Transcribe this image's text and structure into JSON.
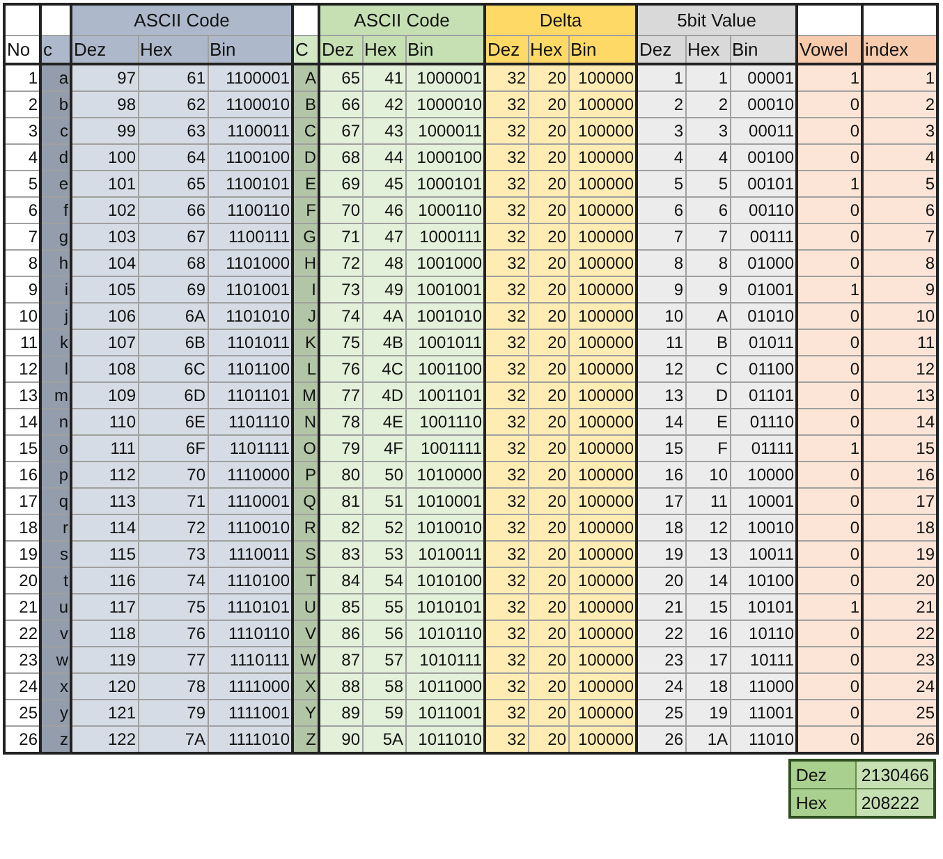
{
  "groups": [
    {
      "kind": "plain",
      "columns": [
        "No"
      ]
    },
    {
      "kind": "key",
      "color": "#adb9ca",
      "columns": [
        "c"
      ]
    },
    {
      "kind": "band",
      "label": "ASCII Code",
      "color": "#adb9ca",
      "columns": [
        "Dez",
        "Hex",
        "Bin"
      ]
    },
    {
      "kind": "key",
      "color": "#d3e8c5",
      "columns": [
        "C"
      ]
    },
    {
      "kind": "band",
      "label": "ASCII Code",
      "color": "#c6e0b4",
      "columns": [
        "Dez",
        "Hex",
        "Bin"
      ]
    },
    {
      "kind": "band",
      "label": "Delta",
      "color": "#ffd966",
      "columns": [
        "Dez",
        "Hex",
        "Bin"
      ]
    },
    {
      "kind": "band",
      "label": "5bit Value",
      "color": "#d9d9d9",
      "columns": [
        "Dez",
        "Hex",
        "Bin"
      ]
    },
    {
      "kind": "band",
      "color": "#f8cbad",
      "columns": [
        "Vowel"
      ]
    },
    {
      "kind": "band",
      "color": "#f8cbad",
      "columns": [
        "index"
      ]
    }
  ],
  "rows": [
    [
      "1",
      "a",
      "97",
      "61",
      "1100001",
      "A",
      "65",
      "41",
      "1000001",
      "32",
      "20",
      "100000",
      "1",
      "1",
      "00001",
      "1",
      "1"
    ],
    [
      "2",
      "b",
      "98",
      "62",
      "1100010",
      "B",
      "66",
      "42",
      "1000010",
      "32",
      "20",
      "100000",
      "2",
      "2",
      "00010",
      "0",
      "2"
    ],
    [
      "3",
      "c",
      "99",
      "63",
      "1100011",
      "C",
      "67",
      "43",
      "1000011",
      "32",
      "20",
      "100000",
      "3",
      "3",
      "00011",
      "0",
      "3"
    ],
    [
      "4",
      "d",
      "100",
      "64",
      "1100100",
      "D",
      "68",
      "44",
      "1000100",
      "32",
      "20",
      "100000",
      "4",
      "4",
      "00100",
      "0",
      "4"
    ],
    [
      "5",
      "e",
      "101",
      "65",
      "1100101",
      "E",
      "69",
      "45",
      "1000101",
      "32",
      "20",
      "100000",
      "5",
      "5",
      "00101",
      "1",
      "5"
    ],
    [
      "6",
      "f",
      "102",
      "66",
      "1100110",
      "F",
      "70",
      "46",
      "1000110",
      "32",
      "20",
      "100000",
      "6",
      "6",
      "00110",
      "0",
      "6"
    ],
    [
      "7",
      "g",
      "103",
      "67",
      "1100111",
      "G",
      "71",
      "47",
      "1000111",
      "32",
      "20",
      "100000",
      "7",
      "7",
      "00111",
      "0",
      "7"
    ],
    [
      "8",
      "h",
      "104",
      "68",
      "1101000",
      "H",
      "72",
      "48",
      "1001000",
      "32",
      "20",
      "100000",
      "8",
      "8",
      "01000",
      "0",
      "8"
    ],
    [
      "9",
      "i",
      "105",
      "69",
      "1101001",
      "I",
      "73",
      "49",
      "1001001",
      "32",
      "20",
      "100000",
      "9",
      "9",
      "01001",
      "1",
      "9"
    ],
    [
      "10",
      "j",
      "106",
      "6A",
      "1101010",
      "J",
      "74",
      "4A",
      "1001010",
      "32",
      "20",
      "100000",
      "10",
      "A",
      "01010",
      "0",
      "10"
    ],
    [
      "11",
      "k",
      "107",
      "6B",
      "1101011",
      "K",
      "75",
      "4B",
      "1001011",
      "32",
      "20",
      "100000",
      "11",
      "B",
      "01011",
      "0",
      "11"
    ],
    [
      "12",
      "l",
      "108",
      "6C",
      "1101100",
      "L",
      "76",
      "4C",
      "1001100",
      "32",
      "20",
      "100000",
      "12",
      "C",
      "01100",
      "0",
      "12"
    ],
    [
      "13",
      "m",
      "109",
      "6D",
      "1101101",
      "M",
      "77",
      "4D",
      "1001101",
      "32",
      "20",
      "100000",
      "13",
      "D",
      "01101",
      "0",
      "13"
    ],
    [
      "14",
      "n",
      "110",
      "6E",
      "1101110",
      "N",
      "78",
      "4E",
      "1001110",
      "32",
      "20",
      "100000",
      "14",
      "E",
      "01110",
      "0",
      "14"
    ],
    [
      "15",
      "o",
      "111",
      "6F",
      "1101111",
      "O",
      "79",
      "4F",
      "1001111",
      "32",
      "20",
      "100000",
      "15",
      "F",
      "01111",
      "1",
      "15"
    ],
    [
      "16",
      "p",
      "112",
      "70",
      "1110000",
      "P",
      "80",
      "50",
      "1010000",
      "32",
      "20",
      "100000",
      "16",
      "10",
      "10000",
      "0",
      "16"
    ],
    [
      "17",
      "q",
      "113",
      "71",
      "1110001",
      "Q",
      "81",
      "51",
      "1010001",
      "32",
      "20",
      "100000",
      "17",
      "11",
      "10001",
      "0",
      "17"
    ],
    [
      "18",
      "r",
      "114",
      "72",
      "1110010",
      "R",
      "82",
      "52",
      "1010010",
      "32",
      "20",
      "100000",
      "18",
      "12",
      "10010",
      "0",
      "18"
    ],
    [
      "19",
      "s",
      "115",
      "73",
      "1110011",
      "S",
      "83",
      "53",
      "1010011",
      "32",
      "20",
      "100000",
      "19",
      "13",
      "10011",
      "0",
      "19"
    ],
    [
      "20",
      "t",
      "116",
      "74",
      "1110100",
      "T",
      "84",
      "54",
      "1010100",
      "32",
      "20",
      "100000",
      "20",
      "14",
      "10100",
      "0",
      "20"
    ],
    [
      "21",
      "u",
      "117",
      "75",
      "1110101",
      "U",
      "85",
      "55",
      "1010101",
      "32",
      "20",
      "100000",
      "21",
      "15",
      "10101",
      "1",
      "21"
    ],
    [
      "22",
      "v",
      "118",
      "76",
      "1110110",
      "V",
      "86",
      "56",
      "1010110",
      "32",
      "20",
      "100000",
      "22",
      "16",
      "10110",
      "0",
      "22"
    ],
    [
      "23",
      "w",
      "119",
      "77",
      "1110111",
      "W",
      "87",
      "57",
      "1010111",
      "32",
      "20",
      "100000",
      "23",
      "17",
      "10111",
      "0",
      "23"
    ],
    [
      "24",
      "x",
      "120",
      "78",
      "1111000",
      "X",
      "88",
      "58",
      "1011000",
      "32",
      "20",
      "100000",
      "24",
      "18",
      "11000",
      "0",
      "24"
    ],
    [
      "25",
      "y",
      "121",
      "79",
      "1111001",
      "Y",
      "89",
      "59",
      "1011001",
      "32",
      "20",
      "100000",
      "25",
      "19",
      "11001",
      "0",
      "25"
    ],
    [
      "26",
      "z",
      "122",
      "7A",
      "1111010",
      "Z",
      "90",
      "5A",
      "1011010",
      "32",
      "20",
      "100000",
      "26",
      "1A",
      "11010",
      "0",
      "26"
    ]
  ],
  "summary": [
    {
      "label": "Dez",
      "value": "2130466",
      "kind": "number"
    },
    {
      "label": "Hex",
      "value": "208222",
      "kind": "text"
    }
  ]
}
